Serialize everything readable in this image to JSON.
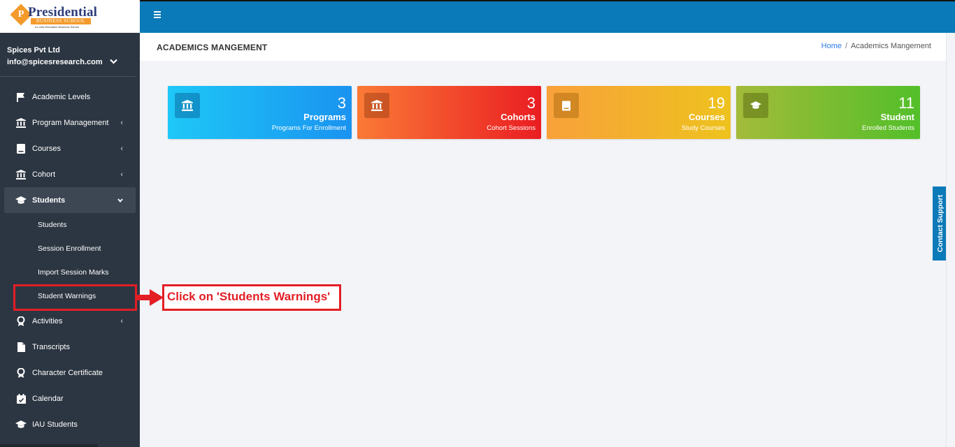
{
  "brand": {
    "title": "Presidential",
    "subtitle": "BUSINESS SCHOOL",
    "tagline": "a Lords Education Business School",
    "initial": "P"
  },
  "user": {
    "company": "Spices Pvt Ltd",
    "email": "info@spicesresearch.com"
  },
  "sidebar": {
    "items": [
      {
        "label": "Academic Levels",
        "icon": "flag-icon"
      },
      {
        "label": "Program Management",
        "icon": "bank-icon"
      },
      {
        "label": "Courses",
        "icon": "book-icon"
      },
      {
        "label": "Cohort",
        "icon": "bank-icon"
      },
      {
        "label": "Students",
        "icon": "graduation-cap-icon"
      },
      {
        "label": "Activities",
        "icon": "award-icon"
      },
      {
        "label": "Transcripts",
        "icon": "document-icon"
      },
      {
        "label": "Character Certificate",
        "icon": "award-icon"
      },
      {
        "label": "Calendar",
        "icon": "calendar-check-icon"
      },
      {
        "label": "IAU Students",
        "icon": "graduation-cap-icon"
      }
    ],
    "students_sub": [
      "Students",
      "Session Enrollment",
      "Import Session Marks",
      "Student Warnings"
    ]
  },
  "page": {
    "title": "ACADEMICS MANGEMENT",
    "breadcrumb_home": "Home",
    "breadcrumb_sep": "/",
    "breadcrumb_current": "Academics Mangement"
  },
  "cards": [
    {
      "value": "3",
      "title": "Programs",
      "subtitle": "Programs For Enrollment",
      "icon": "bank-icon"
    },
    {
      "value": "3",
      "title": "Cohorts",
      "subtitle": "Cohort Sessions",
      "icon": "bank-icon"
    },
    {
      "value": "19",
      "title": "Courses",
      "subtitle": "Study Courses",
      "icon": "book-icon"
    },
    {
      "value": "11",
      "title": "Student",
      "subtitle": "Enrolled Students",
      "icon": "graduation-cap-icon"
    }
  ],
  "annotation": {
    "text": "Click on 'Students Warnings'",
    "color": "#e31e25"
  },
  "support": {
    "label": "Contact Support"
  },
  "colors": {
    "sidebar_bg": "#2c3642",
    "topbar_bg": "#0a7ab8",
    "accent_orange": "#f39a2b"
  }
}
